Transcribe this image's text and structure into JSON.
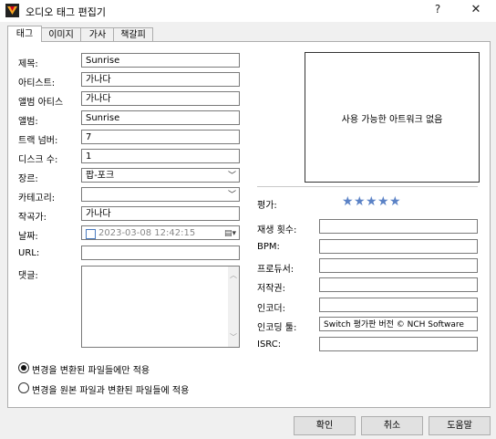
{
  "window": {
    "title": "오디오 태그 편집기",
    "help": "?",
    "close": "✕"
  },
  "tabs": [
    "태그",
    "이미지",
    "가사",
    "책갈피"
  ],
  "left_fields": {
    "title_label": "제목:",
    "title_value": "Sunrise",
    "artist_label": "아티스트:",
    "artist_value": "가나다",
    "album_artist_label": "앨범 아티스",
    "album_artist_value": "가나다",
    "album_label": "앨범:",
    "album_value": "Sunrise",
    "track_label": "트랙 넘버:",
    "track_value": "7",
    "disc_label": "디스크 수:",
    "disc_value": "1",
    "genre_label": "장르:",
    "genre_value": "팝-포크",
    "category_label": "카테고리:",
    "category_value": "",
    "composer_label": "작곡가:",
    "composer_value": "가나다",
    "date_label": "날짜:",
    "date_value": "2023-03-08 12:42:15",
    "url_label": "URL:",
    "url_value": "",
    "comment_label": "댓글:",
    "comment_value": ""
  },
  "artwork": {
    "empty_text": "사용 가능한 아트워크 없음"
  },
  "right_fields": {
    "rating_label": "평가:",
    "rating_value": 5,
    "rating_max": 5,
    "playcount_label": "재생 횟수:",
    "playcount_value": "",
    "bpm_label": "BPM:",
    "bpm_value": "",
    "producer_label": "프로듀서:",
    "producer_value": "",
    "copyright_label": "저작권:",
    "copyright_value": "",
    "encoder_label": "인코더:",
    "encoder_value": "",
    "encoding_tool_label": "인코딩 툴:",
    "encoding_tool_value": "Switch 평가판 버전 © NCH Software",
    "isrc_label": "ISRC:",
    "isrc_value": ""
  },
  "options": {
    "radio1": "변경을 변환된 파일들에만 적용",
    "radio2": "변경을 원본 파일과 변환된 파일들에 적용",
    "selected": 1
  },
  "buttons": {
    "ok": "확인",
    "cancel": "취소",
    "help": "도움말"
  },
  "colors": {
    "star": "#5b82c6",
    "checkbox_border": "#4a7bbf"
  }
}
